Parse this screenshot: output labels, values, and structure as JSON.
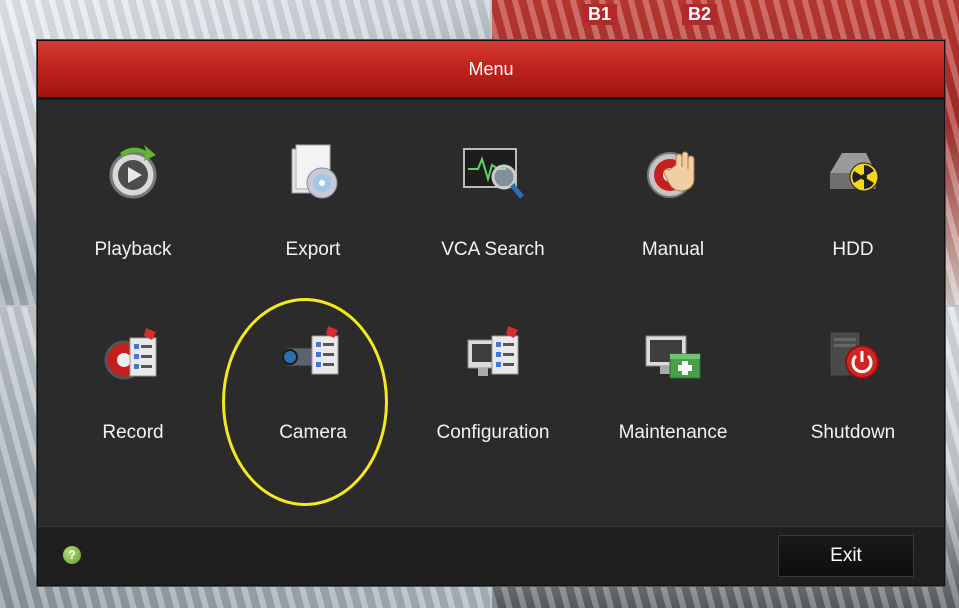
{
  "menu": {
    "title": "Menu",
    "items": [
      {
        "label": "Playback",
        "icon": "playback-icon"
      },
      {
        "label": "Export",
        "icon": "export-icon"
      },
      {
        "label": "VCA Search",
        "icon": "vca-search-icon"
      },
      {
        "label": "Manual",
        "icon": "manual-icon"
      },
      {
        "label": "HDD",
        "icon": "hdd-icon"
      },
      {
        "label": "Record",
        "icon": "record-icon"
      },
      {
        "label": "Camera",
        "icon": "camera-icon"
      },
      {
        "label": "Configuration",
        "icon": "configuration-icon"
      },
      {
        "label": "Maintenance",
        "icon": "maintenance-icon"
      },
      {
        "label": "Shutdown",
        "icon": "shutdown-icon"
      }
    ]
  },
  "footer": {
    "help_icon": "?",
    "exit_label": "Exit"
  },
  "background": {
    "gate_labels": [
      "B1",
      "B2"
    ]
  },
  "colors": {
    "titlebar_red": "#c0241f",
    "panel_dark": "#2b2b2b",
    "highlight_yellow": "#f2ea1e"
  }
}
